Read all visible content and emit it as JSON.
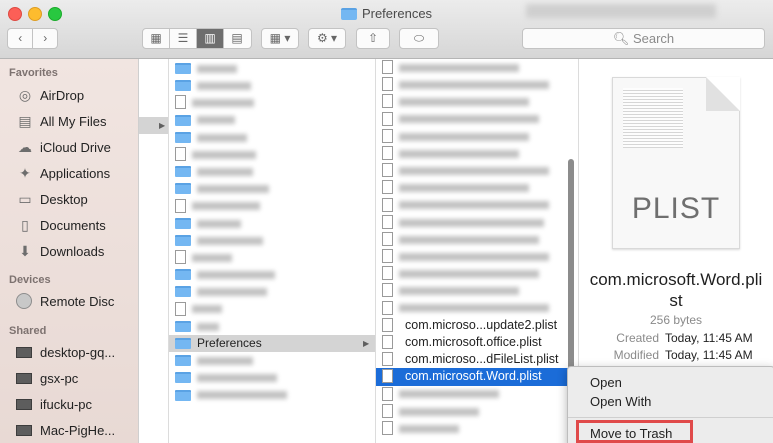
{
  "window": {
    "title": "Preferences"
  },
  "toolbar": {
    "back_label": "‹",
    "forward_label": "›",
    "search_placeholder": "Search"
  },
  "sidebar": {
    "favorites_header": "Favorites",
    "favorites": [
      {
        "label": "AirDrop",
        "icon": "airdrop-icon"
      },
      {
        "label": "All My Files",
        "icon": "all-files-icon"
      },
      {
        "label": "iCloud Drive",
        "icon": "cloud-icon"
      },
      {
        "label": "Applications",
        "icon": "applications-icon"
      },
      {
        "label": "Desktop",
        "icon": "desktop-icon"
      },
      {
        "label": "Documents",
        "icon": "documents-icon"
      },
      {
        "label": "Downloads",
        "icon": "downloads-icon"
      }
    ],
    "devices_header": "Devices",
    "devices": [
      {
        "label": "Remote Disc",
        "icon": "disc-icon"
      }
    ],
    "shared_header": "Shared",
    "shared": [
      {
        "label": "desktop-gq...",
        "icon": "computer-icon"
      },
      {
        "label": "gsx-pc",
        "icon": "computer-icon"
      },
      {
        "label": "ifucku-pc",
        "icon": "computer-icon"
      },
      {
        "label": "Mac-PigHe...",
        "icon": "computer-icon"
      }
    ]
  },
  "column2": {
    "selected_label": "Preferences"
  },
  "column3": {
    "visible_items": [
      "com.microso...update2.plist",
      "com.microsoft.office.plist",
      "com.microso...dFileList.plist",
      "com.microsoft.Word.plist"
    ]
  },
  "preview": {
    "type_label": "PLIST",
    "name_line1": "com.microsoft.Word.pli",
    "name_line2": "st",
    "size": "256 bytes",
    "created_key": "Created",
    "created_val": "Today, 11:45 AM",
    "modified_key": "Modified",
    "modified_val": "Today, 11:45 AM"
  },
  "context_menu": {
    "open": "Open",
    "open_with": "Open With",
    "move_to_trash": "Move to Trash"
  },
  "colors": {
    "selection": "#1b6cd8",
    "highlight_box": "#e04a4a",
    "folder": "#74b7f2"
  }
}
